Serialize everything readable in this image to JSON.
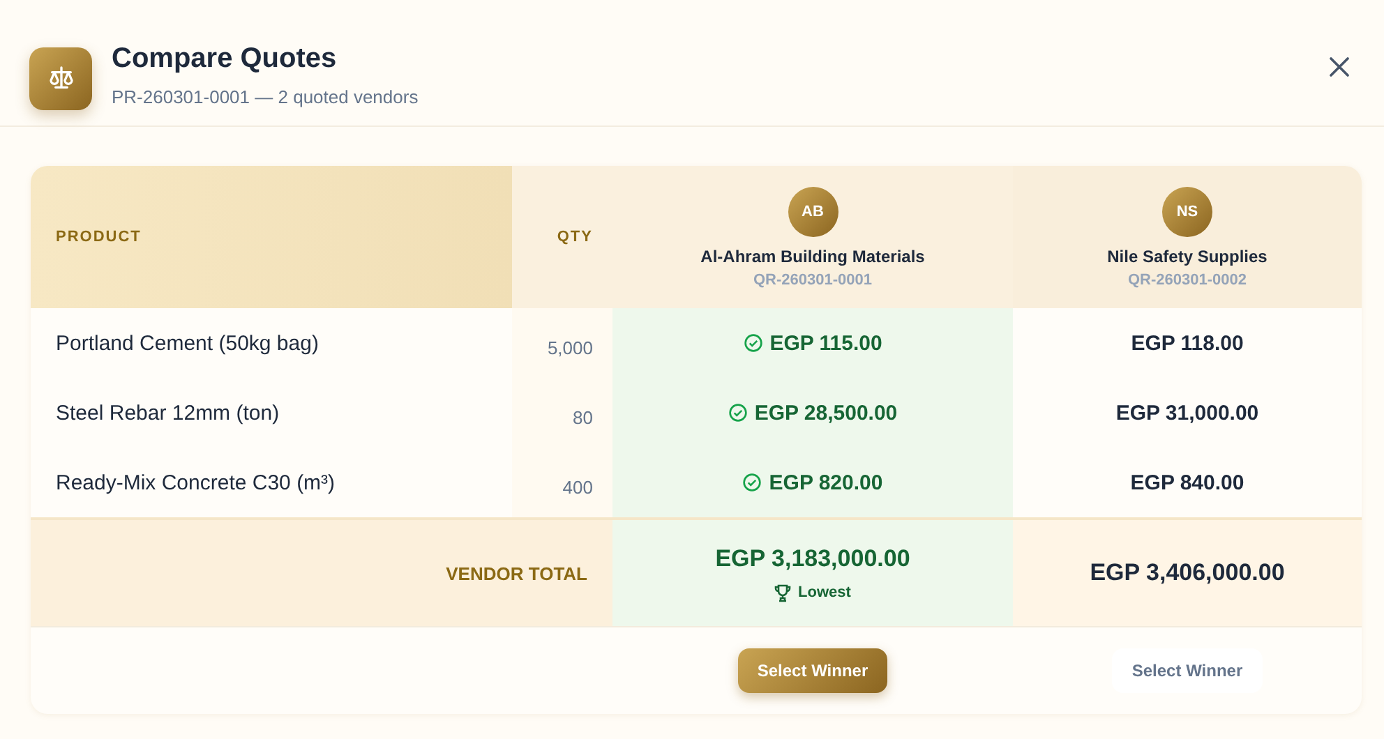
{
  "dialog": {
    "title": "Compare Quotes",
    "subtitle": "PR-260301-0001 — 2 quoted vendors"
  },
  "table": {
    "columns": {
      "product": "PRODUCT",
      "qty": "QTY"
    },
    "vendors": [
      {
        "initials": "AB",
        "name": "Al-Ahram Building Materials",
        "quote": "QR-260301-0001",
        "total": "EGP 3,183,000.00",
        "lowest": true,
        "badge": "Lowest",
        "button": "Select Winner",
        "primary": true
      },
      {
        "initials": "NS",
        "name": "Nile Safety Supplies",
        "quote": "QR-260301-0002",
        "total": "EGP 3,406,000.00",
        "lowest": false,
        "button": "Select Winner",
        "primary": false
      }
    ],
    "rows": [
      {
        "product": "Portland Cement (50kg bag)",
        "qty": "5,000",
        "prices": [
          {
            "value": "EGP 115.00",
            "best": true
          },
          {
            "value": "EGP 118.00",
            "best": false
          }
        ]
      },
      {
        "product": "Steel Rebar 12mm (ton)",
        "qty": "80",
        "prices": [
          {
            "value": "EGP 28,500.00",
            "best": true
          },
          {
            "value": "EGP 31,000.00",
            "best": false
          }
        ]
      },
      {
        "product": "Ready-Mix Concrete C30 (m³)",
        "qty": "400",
        "prices": [
          {
            "value": "EGP 820.00",
            "best": true
          },
          {
            "value": "EGP 840.00",
            "best": false
          }
        ]
      }
    ],
    "total_label": "VENDOR TOTAL"
  }
}
